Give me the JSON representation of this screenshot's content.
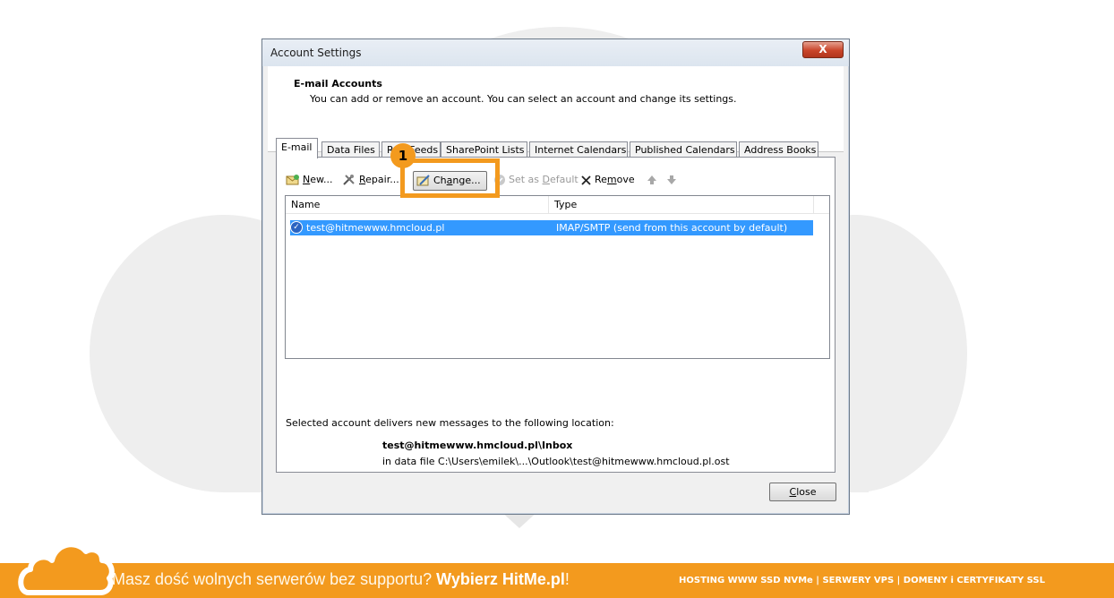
{
  "window": {
    "title": "Account Settings",
    "close_glyph": "X"
  },
  "header": {
    "title": "E-mail Accounts",
    "description": "You can add or remove an account. You can select an account and change its settings."
  },
  "tabs": [
    {
      "label": "E-mail"
    },
    {
      "label": "Data Files"
    },
    {
      "label": "RSS Feeds"
    },
    {
      "label": "SharePoint Lists"
    },
    {
      "label": "Internet Calendars"
    },
    {
      "label": "Published Calendars"
    },
    {
      "label": "Address Books"
    }
  ],
  "toolbar": {
    "new_pre": "",
    "new_u": "N",
    "new_post": "ew...",
    "repair_pre": "",
    "repair_u": "R",
    "repair_post": "epair...",
    "change_pre": "Ch",
    "change_u": "a",
    "change_post": "nge...",
    "default_pre": "Set as ",
    "default_u": "D",
    "default_post": "efault",
    "remove_pre": "Re",
    "remove_u": "m",
    "remove_post": "ove"
  },
  "list": {
    "col_name": "Name",
    "col_type": "Type",
    "rows": [
      {
        "name": "test@hitmewww.hmcloud.pl",
        "type": "IMAP/SMTP (send from this account by default)"
      }
    ]
  },
  "delivery": {
    "label": "Selected account delivers new messages to the following location:",
    "account": "test@hitmewww.hmcloud.pl\\Inbox",
    "path": "in data file C:\\Users\\emilek\\...\\Outlook\\test@hitmewww.hmcloud.pl.ost"
  },
  "close_button": {
    "u": "C",
    "post": "lose"
  },
  "annotation": {
    "badge": "1",
    "color": "#f39a1e"
  },
  "banner": {
    "slogan": "Masz dość wolnych serwerów bez supportu? ",
    "brand": "Wybierz HitMe.pl",
    "exclaim": "!",
    "services": "HOSTING WWW SSD NVMe | SERWERY VPS | DOMENY i CERTYFIKATY SSL",
    "color": "#f39a1e"
  },
  "icons": [
    "new-account-icon",
    "repair-icon",
    "change-icon",
    "set-default-icon",
    "remove-icon",
    "move-up-icon",
    "move-down-icon",
    "default-account-check-icon",
    "cloud-logo-icon"
  ]
}
